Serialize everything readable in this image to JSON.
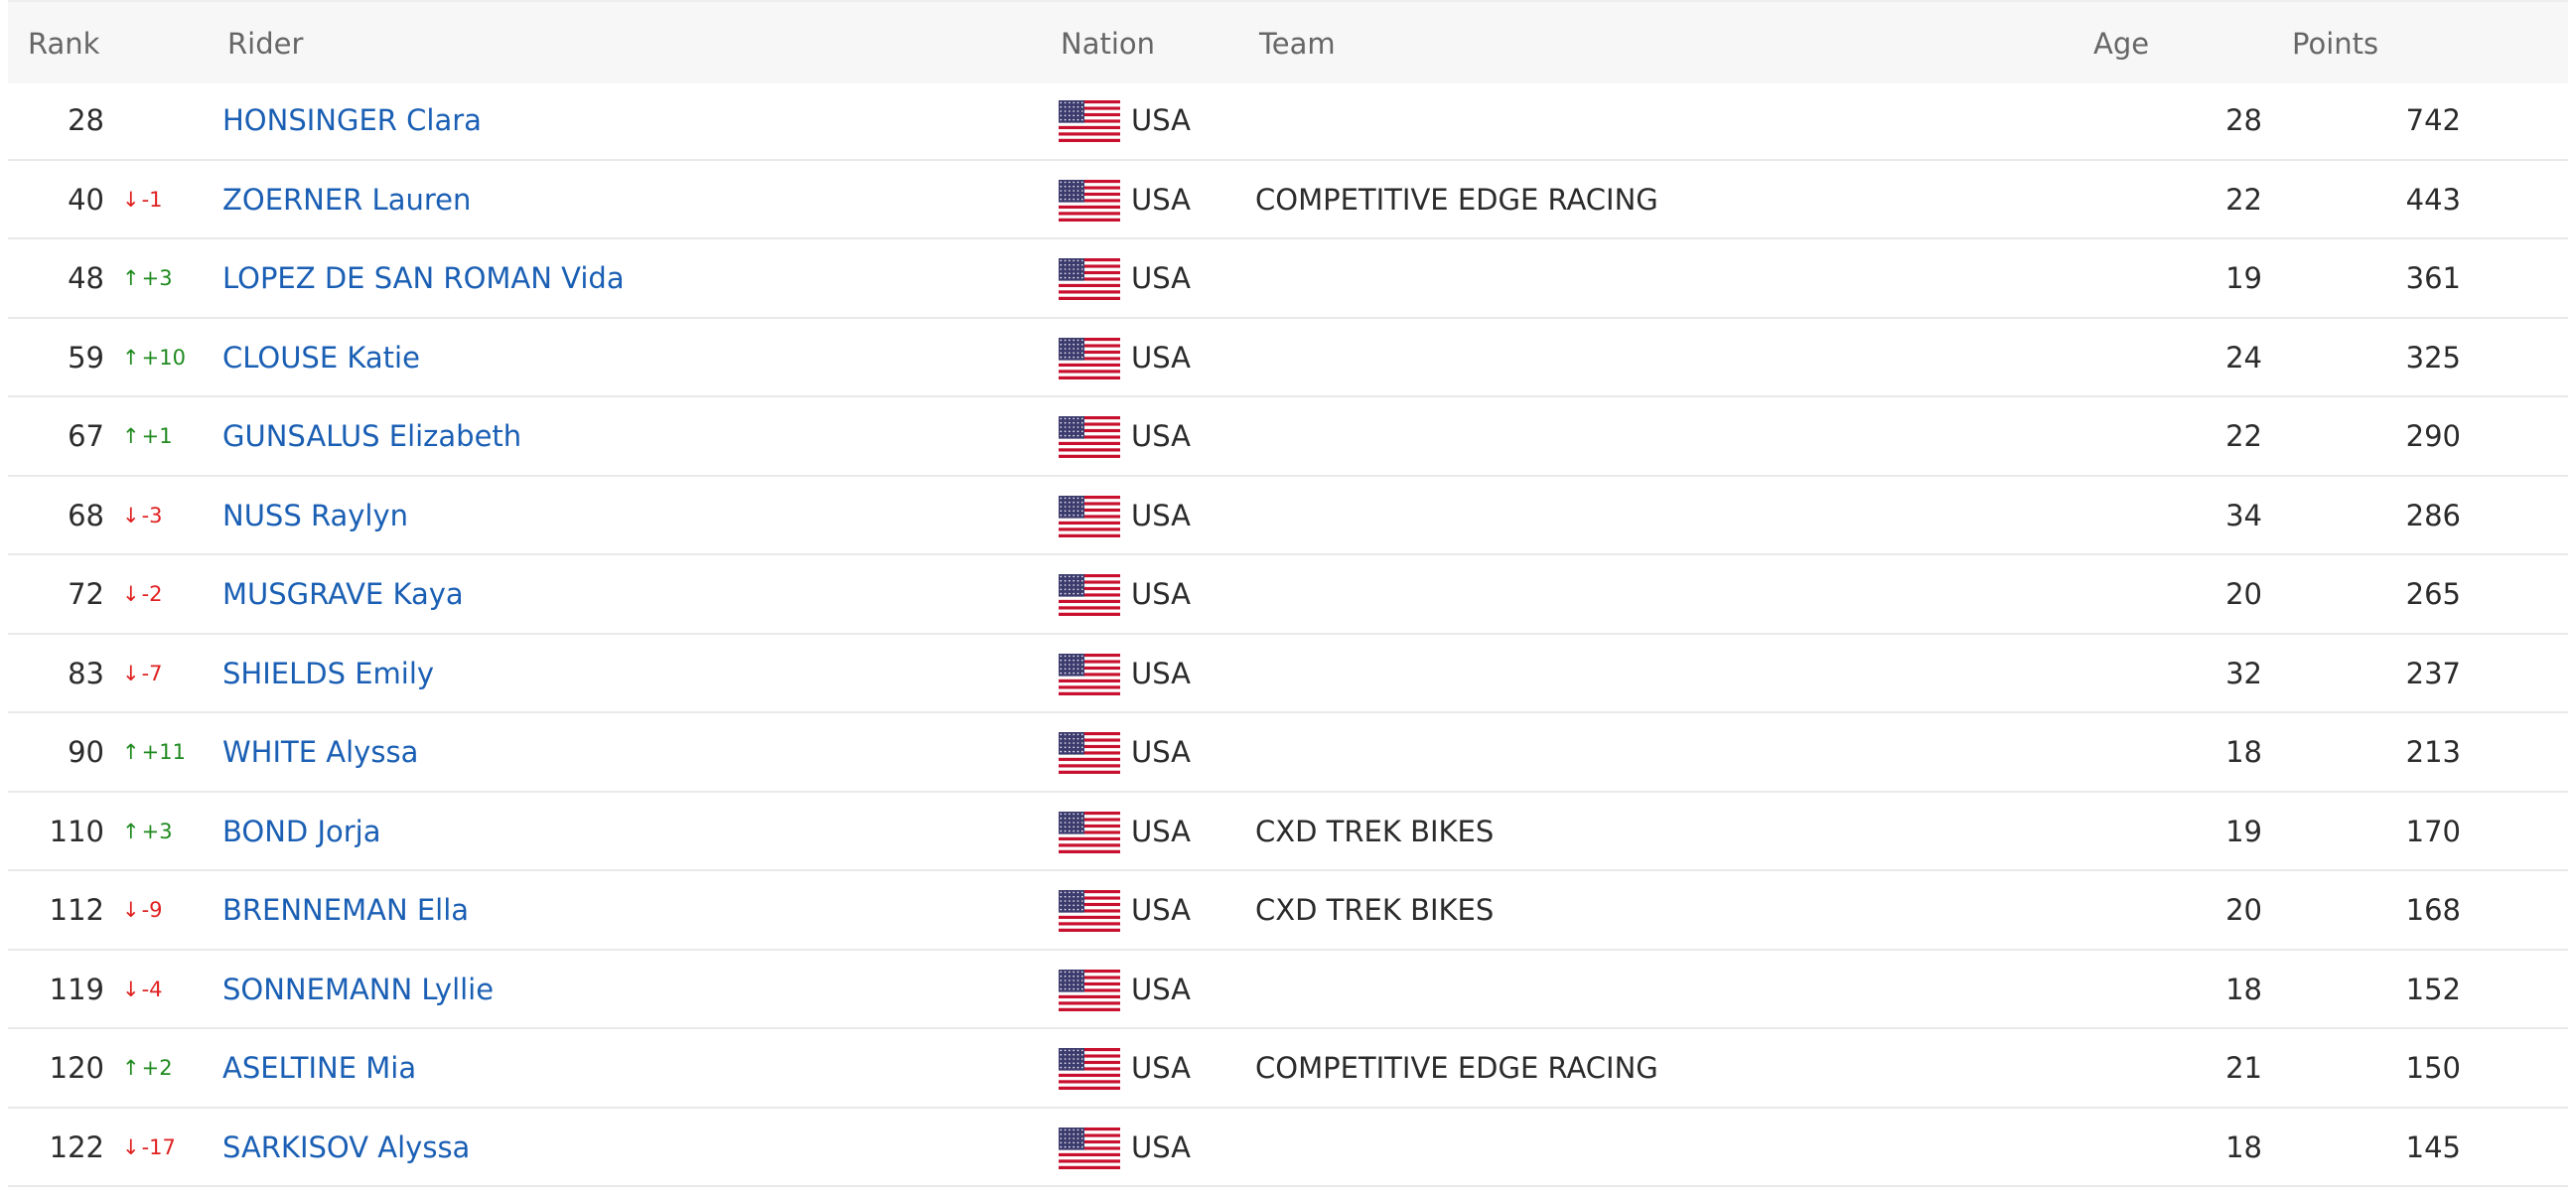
{
  "header": {
    "rank": "Rank",
    "rider": "Rider",
    "nation": "Nation",
    "team": "Team",
    "age": "Age",
    "points": "Points"
  },
  "flag_colors": {
    "red": "#c8102e",
    "white": "#ffffff",
    "blue": "#3c3b6e"
  },
  "rows": [
    {
      "rank": "28",
      "delta": "",
      "trend": "none",
      "rider": "HONSINGER Clara",
      "nation": "USA",
      "team": "",
      "age": "28",
      "points": "742"
    },
    {
      "rank": "40",
      "delta": "-1",
      "trend": "down",
      "rider": "ZOERNER Lauren",
      "nation": "USA",
      "team": "COMPETITIVE EDGE RACING",
      "age": "22",
      "points": "443"
    },
    {
      "rank": "48",
      "delta": "+3",
      "trend": "up",
      "rider": "LOPEZ DE SAN ROMAN Vida",
      "nation": "USA",
      "team": "",
      "age": "19",
      "points": "361"
    },
    {
      "rank": "59",
      "delta": "+10",
      "trend": "up",
      "rider": "CLOUSE Katie",
      "nation": "USA",
      "team": "",
      "age": "24",
      "points": "325"
    },
    {
      "rank": "67",
      "delta": "+1",
      "trend": "up",
      "rider": "GUNSALUS Elizabeth",
      "nation": "USA",
      "team": "",
      "age": "22",
      "points": "290"
    },
    {
      "rank": "68",
      "delta": "-3",
      "trend": "down",
      "rider": "NUSS Raylyn",
      "nation": "USA",
      "team": "",
      "age": "34",
      "points": "286"
    },
    {
      "rank": "72",
      "delta": "-2",
      "trend": "down",
      "rider": "MUSGRAVE Kaya",
      "nation": "USA",
      "team": "",
      "age": "20",
      "points": "265"
    },
    {
      "rank": "83",
      "delta": "-7",
      "trend": "down",
      "rider": "SHIELDS Emily",
      "nation": "USA",
      "team": "",
      "age": "32",
      "points": "237"
    },
    {
      "rank": "90",
      "delta": "+11",
      "trend": "up",
      "rider": "WHITE Alyssa",
      "nation": "USA",
      "team": "",
      "age": "18",
      "points": "213"
    },
    {
      "rank": "110",
      "delta": "+3",
      "trend": "up",
      "rider": "BOND Jorja",
      "nation": "USA",
      "team": "CXD TREK BIKES",
      "age": "19",
      "points": "170"
    },
    {
      "rank": "112",
      "delta": "-9",
      "trend": "down",
      "rider": "BRENNEMAN Ella",
      "nation": "USA",
      "team": "CXD TREK BIKES",
      "age": "20",
      "points": "168"
    },
    {
      "rank": "119",
      "delta": "-4",
      "trend": "down",
      "rider": "SONNEMANN Lyllie",
      "nation": "USA",
      "team": "",
      "age": "18",
      "points": "152"
    },
    {
      "rank": "120",
      "delta": "+2",
      "trend": "up",
      "rider": "ASELTINE Mia",
      "nation": "USA",
      "team": "COMPETITIVE EDGE RACING",
      "age": "21",
      "points": "150"
    },
    {
      "rank": "122",
      "delta": "-17",
      "trend": "down",
      "rider": "SARKISOV Alyssa",
      "nation": "USA",
      "team": "",
      "age": "18",
      "points": "145"
    }
  ]
}
